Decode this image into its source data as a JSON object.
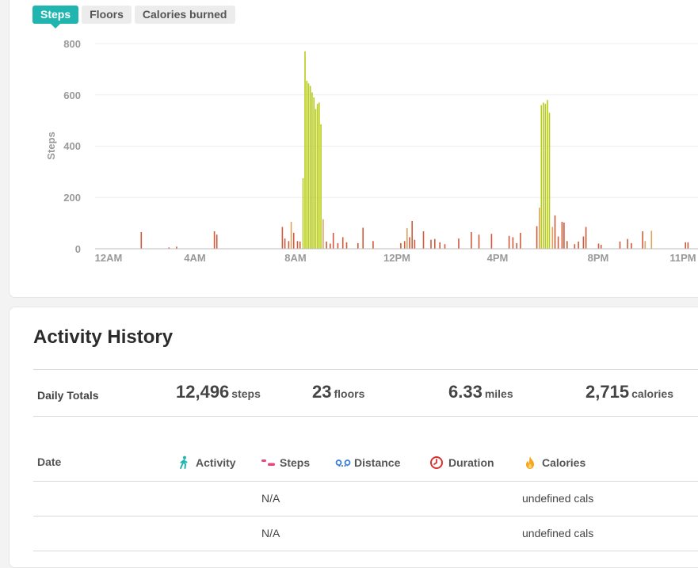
{
  "tabs": [
    {
      "label": "Steps",
      "active": true
    },
    {
      "label": "Floors",
      "active": false
    },
    {
      "label": "Calories burned",
      "active": false
    }
  ],
  "chart_data": {
    "type": "bar",
    "ylabel": "Steps",
    "ylim": [
      0,
      800
    ],
    "y_ticks": [
      "0",
      "200",
      "400",
      "600",
      "800"
    ],
    "x_tick_labels": [
      "12AM",
      "4AM",
      "8AM",
      "12PM",
      "4PM",
      "8PM",
      "11PM"
    ],
    "x_unit": "hour of day",
    "grid": true,
    "colors": {
      "active": "#b8cc1a",
      "light": "#e0a25a",
      "low": "#cf5a3c"
    },
    "bars": [
      {
        "x": 1.3,
        "y": 65,
        "level": "low"
      },
      {
        "x": 2.4,
        "y": 5,
        "level": "low"
      },
      {
        "x": 2.7,
        "y": 8,
        "level": "low"
      },
      {
        "x": 4.2,
        "y": 68,
        "level": "low"
      },
      {
        "x": 4.3,
        "y": 55,
        "level": "low"
      },
      {
        "x": 6.9,
        "y": 85,
        "level": "low"
      },
      {
        "x": 7.0,
        "y": 40,
        "level": "low"
      },
      {
        "x": 7.15,
        "y": 30,
        "level": "low"
      },
      {
        "x": 7.25,
        "y": 105,
        "level": "light"
      },
      {
        "x": 7.35,
        "y": 62,
        "level": "low"
      },
      {
        "x": 7.5,
        "y": 30,
        "level": "low"
      },
      {
        "x": 7.6,
        "y": 28,
        "level": "low"
      },
      {
        "x": 7.72,
        "y": 275,
        "level": "active"
      },
      {
        "x": 7.8,
        "y": 770,
        "level": "active"
      },
      {
        "x": 7.87,
        "y": 655,
        "level": "active"
      },
      {
        "x": 7.94,
        "y": 645,
        "level": "active"
      },
      {
        "x": 8.01,
        "y": 635,
        "level": "active"
      },
      {
        "x": 8.08,
        "y": 610,
        "level": "active"
      },
      {
        "x": 8.15,
        "y": 590,
        "level": "active"
      },
      {
        "x": 8.22,
        "y": 545,
        "level": "active"
      },
      {
        "x": 8.29,
        "y": 565,
        "level": "active"
      },
      {
        "x": 8.36,
        "y": 570,
        "level": "active"
      },
      {
        "x": 8.43,
        "y": 485,
        "level": "active"
      },
      {
        "x": 8.52,
        "y": 115,
        "level": "light"
      },
      {
        "x": 8.65,
        "y": 28,
        "level": "low"
      },
      {
        "x": 8.8,
        "y": 20,
        "level": "low"
      },
      {
        "x": 8.92,
        "y": 62,
        "level": "low"
      },
      {
        "x": 9.1,
        "y": 22,
        "level": "low"
      },
      {
        "x": 9.3,
        "y": 45,
        "level": "low"
      },
      {
        "x": 9.45,
        "y": 25,
        "level": "low"
      },
      {
        "x": 9.9,
        "y": 22,
        "level": "low"
      },
      {
        "x": 10.1,
        "y": 82,
        "level": "low"
      },
      {
        "x": 10.5,
        "y": 30,
        "level": "low"
      },
      {
        "x": 11.6,
        "y": 22,
        "level": "low"
      },
      {
        "x": 11.75,
        "y": 30,
        "level": "low"
      },
      {
        "x": 11.85,
        "y": 80,
        "level": "light"
      },
      {
        "x": 11.95,
        "y": 45,
        "level": "low"
      },
      {
        "x": 12.05,
        "y": 108,
        "level": "low"
      },
      {
        "x": 12.15,
        "y": 35,
        "level": "low"
      },
      {
        "x": 12.5,
        "y": 68,
        "level": "low"
      },
      {
        "x": 12.8,
        "y": 35,
        "level": "low"
      },
      {
        "x": 12.95,
        "y": 38,
        "level": "low"
      },
      {
        "x": 13.15,
        "y": 25,
        "level": "low"
      },
      {
        "x": 13.35,
        "y": 18,
        "level": "low"
      },
      {
        "x": 13.9,
        "y": 40,
        "level": "low"
      },
      {
        "x": 14.4,
        "y": 65,
        "level": "low"
      },
      {
        "x": 14.7,
        "y": 55,
        "level": "low"
      },
      {
        "x": 15.2,
        "y": 58,
        "level": "low"
      },
      {
        "x": 15.9,
        "y": 50,
        "level": "low"
      },
      {
        "x": 16.05,
        "y": 45,
        "level": "low"
      },
      {
        "x": 16.2,
        "y": 22,
        "level": "low"
      },
      {
        "x": 16.35,
        "y": 62,
        "level": "low"
      },
      {
        "x": 17.0,
        "y": 88,
        "level": "low"
      },
      {
        "x": 17.1,
        "y": 160,
        "level": "light"
      },
      {
        "x": 17.18,
        "y": 560,
        "level": "active"
      },
      {
        "x": 17.26,
        "y": 570,
        "level": "active"
      },
      {
        "x": 17.34,
        "y": 565,
        "level": "active"
      },
      {
        "x": 17.42,
        "y": 580,
        "level": "active"
      },
      {
        "x": 17.5,
        "y": 530,
        "level": "active"
      },
      {
        "x": 17.62,
        "y": 85,
        "level": "light"
      },
      {
        "x": 17.72,
        "y": 130,
        "level": "low"
      },
      {
        "x": 17.85,
        "y": 48,
        "level": "low"
      },
      {
        "x": 18.0,
        "y": 105,
        "level": "low"
      },
      {
        "x": 18.08,
        "y": 102,
        "level": "low"
      },
      {
        "x": 18.2,
        "y": 30,
        "level": "low"
      },
      {
        "x": 18.5,
        "y": 18,
        "level": "low"
      },
      {
        "x": 18.65,
        "y": 28,
        "level": "low"
      },
      {
        "x": 18.85,
        "y": 48,
        "level": "low"
      },
      {
        "x": 18.95,
        "y": 85,
        "level": "low"
      },
      {
        "x": 19.45,
        "y": 20,
        "level": "low"
      },
      {
        "x": 19.55,
        "y": 15,
        "level": "low"
      },
      {
        "x": 20.3,
        "y": 28,
        "level": "low"
      },
      {
        "x": 20.6,
        "y": 38,
        "level": "low"
      },
      {
        "x": 20.75,
        "y": 22,
        "level": "low"
      },
      {
        "x": 21.2,
        "y": 68,
        "level": "low"
      },
      {
        "x": 21.3,
        "y": 30,
        "level": "light"
      },
      {
        "x": 21.55,
        "y": 70,
        "level": "light"
      },
      {
        "x": 22.9,
        "y": 25,
        "level": "low"
      },
      {
        "x": 23.0,
        "y": 25,
        "level": "low"
      }
    ]
  },
  "history": {
    "title": "Activity History",
    "totals_label": "Daily Totals",
    "totals": [
      {
        "value": "12,496",
        "unit": "steps"
      },
      {
        "value": "23",
        "unit": "floors"
      },
      {
        "value": "6.33",
        "unit": "miles"
      },
      {
        "value": "2,715",
        "unit": "calories"
      }
    ],
    "columns": {
      "date": "Date",
      "activity": "Activity",
      "steps": "Steps",
      "distance": "Distance",
      "duration": "Duration",
      "calories": "Calories"
    },
    "icons": {
      "activity": "walking-person-icon",
      "steps": "footprints-icon",
      "distance": "distance-pin-icon",
      "duration": "clock-icon",
      "calories": "flame-icon"
    },
    "icon_colors": {
      "activity": "#21b5b0",
      "steps": "#e8457a",
      "distance": "#3d7fd6",
      "duration": "#d9302e",
      "calories": "#f5a623"
    },
    "rows": [
      {
        "steps": "N/A",
        "calories": "undefined cals"
      },
      {
        "steps": "N/A",
        "calories": "undefined cals"
      }
    ]
  }
}
